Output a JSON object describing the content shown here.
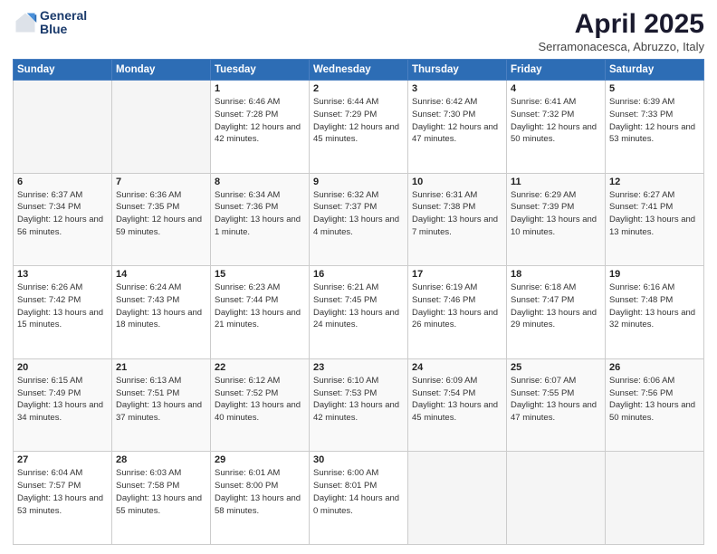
{
  "header": {
    "logo_line1": "General",
    "logo_line2": "Blue",
    "month": "April 2025",
    "location": "Serramonacesca, Abruzzo, Italy"
  },
  "days_of_week": [
    "Sunday",
    "Monday",
    "Tuesday",
    "Wednesday",
    "Thursday",
    "Friday",
    "Saturday"
  ],
  "weeks": [
    [
      {
        "day": "",
        "info": ""
      },
      {
        "day": "",
        "info": ""
      },
      {
        "day": "1",
        "info": "Sunrise: 6:46 AM\nSunset: 7:28 PM\nDaylight: 12 hours and 42 minutes."
      },
      {
        "day": "2",
        "info": "Sunrise: 6:44 AM\nSunset: 7:29 PM\nDaylight: 12 hours and 45 minutes."
      },
      {
        "day": "3",
        "info": "Sunrise: 6:42 AM\nSunset: 7:30 PM\nDaylight: 12 hours and 47 minutes."
      },
      {
        "day": "4",
        "info": "Sunrise: 6:41 AM\nSunset: 7:32 PM\nDaylight: 12 hours and 50 minutes."
      },
      {
        "day": "5",
        "info": "Sunrise: 6:39 AM\nSunset: 7:33 PM\nDaylight: 12 hours and 53 minutes."
      }
    ],
    [
      {
        "day": "6",
        "info": "Sunrise: 6:37 AM\nSunset: 7:34 PM\nDaylight: 12 hours and 56 minutes."
      },
      {
        "day": "7",
        "info": "Sunrise: 6:36 AM\nSunset: 7:35 PM\nDaylight: 12 hours and 59 minutes."
      },
      {
        "day": "8",
        "info": "Sunrise: 6:34 AM\nSunset: 7:36 PM\nDaylight: 13 hours and 1 minute."
      },
      {
        "day": "9",
        "info": "Sunrise: 6:32 AM\nSunset: 7:37 PM\nDaylight: 13 hours and 4 minutes."
      },
      {
        "day": "10",
        "info": "Sunrise: 6:31 AM\nSunset: 7:38 PM\nDaylight: 13 hours and 7 minutes."
      },
      {
        "day": "11",
        "info": "Sunrise: 6:29 AM\nSunset: 7:39 PM\nDaylight: 13 hours and 10 minutes."
      },
      {
        "day": "12",
        "info": "Sunrise: 6:27 AM\nSunset: 7:41 PM\nDaylight: 13 hours and 13 minutes."
      }
    ],
    [
      {
        "day": "13",
        "info": "Sunrise: 6:26 AM\nSunset: 7:42 PM\nDaylight: 13 hours and 15 minutes."
      },
      {
        "day": "14",
        "info": "Sunrise: 6:24 AM\nSunset: 7:43 PM\nDaylight: 13 hours and 18 minutes."
      },
      {
        "day": "15",
        "info": "Sunrise: 6:23 AM\nSunset: 7:44 PM\nDaylight: 13 hours and 21 minutes."
      },
      {
        "day": "16",
        "info": "Sunrise: 6:21 AM\nSunset: 7:45 PM\nDaylight: 13 hours and 24 minutes."
      },
      {
        "day": "17",
        "info": "Sunrise: 6:19 AM\nSunset: 7:46 PM\nDaylight: 13 hours and 26 minutes."
      },
      {
        "day": "18",
        "info": "Sunrise: 6:18 AM\nSunset: 7:47 PM\nDaylight: 13 hours and 29 minutes."
      },
      {
        "day": "19",
        "info": "Sunrise: 6:16 AM\nSunset: 7:48 PM\nDaylight: 13 hours and 32 minutes."
      }
    ],
    [
      {
        "day": "20",
        "info": "Sunrise: 6:15 AM\nSunset: 7:49 PM\nDaylight: 13 hours and 34 minutes."
      },
      {
        "day": "21",
        "info": "Sunrise: 6:13 AM\nSunset: 7:51 PM\nDaylight: 13 hours and 37 minutes."
      },
      {
        "day": "22",
        "info": "Sunrise: 6:12 AM\nSunset: 7:52 PM\nDaylight: 13 hours and 40 minutes."
      },
      {
        "day": "23",
        "info": "Sunrise: 6:10 AM\nSunset: 7:53 PM\nDaylight: 13 hours and 42 minutes."
      },
      {
        "day": "24",
        "info": "Sunrise: 6:09 AM\nSunset: 7:54 PM\nDaylight: 13 hours and 45 minutes."
      },
      {
        "day": "25",
        "info": "Sunrise: 6:07 AM\nSunset: 7:55 PM\nDaylight: 13 hours and 47 minutes."
      },
      {
        "day": "26",
        "info": "Sunrise: 6:06 AM\nSunset: 7:56 PM\nDaylight: 13 hours and 50 minutes."
      }
    ],
    [
      {
        "day": "27",
        "info": "Sunrise: 6:04 AM\nSunset: 7:57 PM\nDaylight: 13 hours and 53 minutes."
      },
      {
        "day": "28",
        "info": "Sunrise: 6:03 AM\nSunset: 7:58 PM\nDaylight: 13 hours and 55 minutes."
      },
      {
        "day": "29",
        "info": "Sunrise: 6:01 AM\nSunset: 8:00 PM\nDaylight: 13 hours and 58 minutes."
      },
      {
        "day": "30",
        "info": "Sunrise: 6:00 AM\nSunset: 8:01 PM\nDaylight: 14 hours and 0 minutes."
      },
      {
        "day": "",
        "info": ""
      },
      {
        "day": "",
        "info": ""
      },
      {
        "day": "",
        "info": ""
      }
    ]
  ]
}
